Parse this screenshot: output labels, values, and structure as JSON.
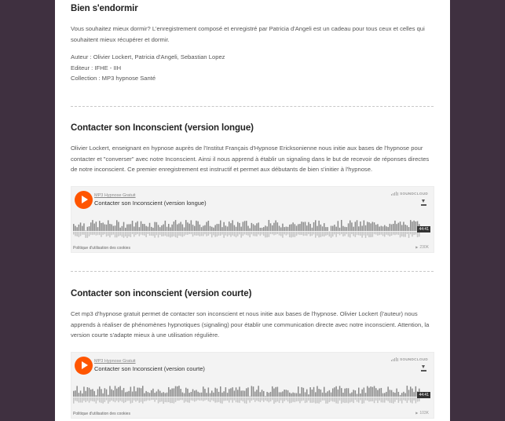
{
  "sections": [
    {
      "title": "Bien s'endormir",
      "paragraphs": [
        "Vous souhaitez mieux dormir? L'enregistrement composé et enregistré par Patricia d'Angeli est un cadeau pour tous ceux et celles qui souhaitent mieux récupérer et dormir."
      ],
      "meta": [
        "Auteur : Olivier Lockert, Patricia d'Angeli, Sebastian Lopez",
        "Editeur : IFHE - IIH",
        "Collection : MP3 hypnose Santé"
      ]
    },
    {
      "title": "Contacter son Inconscient (version longue)",
      "paragraphs": [
        "Olivier Lockert, enseignant en hypnose auprès de l'Institut Français d'Hypnose Ericksonienne nous initie aux bases de l'hypnose pour contacter et \"converser\" avec notre Inconscient. Ainsi il nous apprend à établir un signaling dans le but de recevoir de réponses directes de notre inconscient. Ce premier enregistrement est instructif et permet aux débutants de bien s'initier à l'hypnose."
      ],
      "player": {
        "user": "MP3 Hypnose Gratuit",
        "track": "Contacter son Inconscient (version longue)",
        "duration": "44:41",
        "plays": "230K",
        "cookie": "Politique d'utilisation des cookies",
        "brand": "SOUNDCLOUD"
      }
    },
    {
      "title": "Contacter son inconscient (version courte)",
      "paragraphs": [
        "Cet mp3 d'hypnose gratuit permet de contacter son inconscient et nous initie aux bases de l'hypnose. Olivier Lockert (l'auteur) nous apprends à réaliser de phénomènes hypnotiques (signaling) pour établir une communication directe avec notre inconscient. Attention, la version courte s'adapte mieux à une utilisation régulière."
      ],
      "player": {
        "user": "MP3 Hypnose Gratuit",
        "track": "Contacter son Inconscient (version courte)",
        "duration": "44:41",
        "plays": "103K",
        "cookie": "Politique d'utilisation des cookies",
        "brand": "SOUNDCLOUD"
      }
    }
  ],
  "colors": {
    "background": "#3f3040",
    "accent": "#ff5500",
    "wave": "#8a8a8a"
  }
}
